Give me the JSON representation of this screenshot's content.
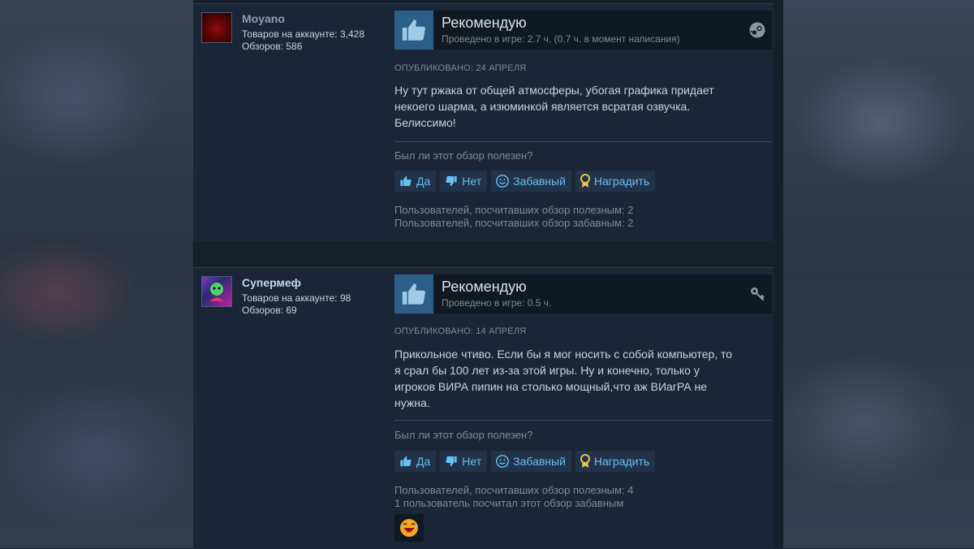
{
  "reviews": [
    {
      "author": "Moyano",
      "products_line": "Товаров на аккаунте: 3,428",
      "reviews_line": "Обзоров: 586",
      "recommendation": "Рекомендую",
      "hours": "Проведено в игре: 2.7 ч. (0.7 ч. в момент написания)",
      "posted": "Опубликовано: 24 апреля",
      "content": [
        "Ну тут ржака от общей атмосферы, убогая графика придает",
        "некоего шарма, а изюминкой является всратая озвучка.",
        "Белиссимо!"
      ],
      "helpful_question": "Был ли этот обзор полезен?",
      "buttons": {
        "yes": "Да",
        "no": "Нет",
        "funny": "Забавный",
        "award": "Наградить"
      },
      "helpful_count": "Пользователей, посчитавших обзор полезным: 2",
      "funny_count": "Пользователей, посчитавших обзор забавным: 2",
      "corner_icon": "steam-logo-icon"
    },
    {
      "author": "Супермеф",
      "products_line": "Товаров на аккаунте: 98",
      "reviews_line": "Обзоров: 69",
      "recommendation": "Рекомендую",
      "hours": "Проведено в игре: 0.5 ч.",
      "posted": "Опубликовано: 14 апреля",
      "content": [
        "Прикольное чтиво. Если бы я мог носить с собой компьютер, то",
        "я срал бы 100 лет из-за этой игры. Ну и конечно, только у",
        "игроков ВИРА пипин на столько мощный,что аж ВИагРА не",
        "нужна."
      ],
      "helpful_question": "Был ли этот обзор полезен?",
      "buttons": {
        "yes": "Да",
        "no": "Нет",
        "funny": "Забавный",
        "award": "Наградить"
      },
      "helpful_count": "Пользователей, посчитавших обзор полезным: 4",
      "funny_count": "1 пользователь посчитал этот обзор забавным",
      "corner_icon": "key-icon",
      "award_icon": "laughing-face-award-icon"
    }
  ],
  "colors": {
    "page_bg": "#1a2233",
    "card_bg": "#1a2637",
    "link_blue": "#66c0f4",
    "thumb_blue": "#2b5f87"
  }
}
